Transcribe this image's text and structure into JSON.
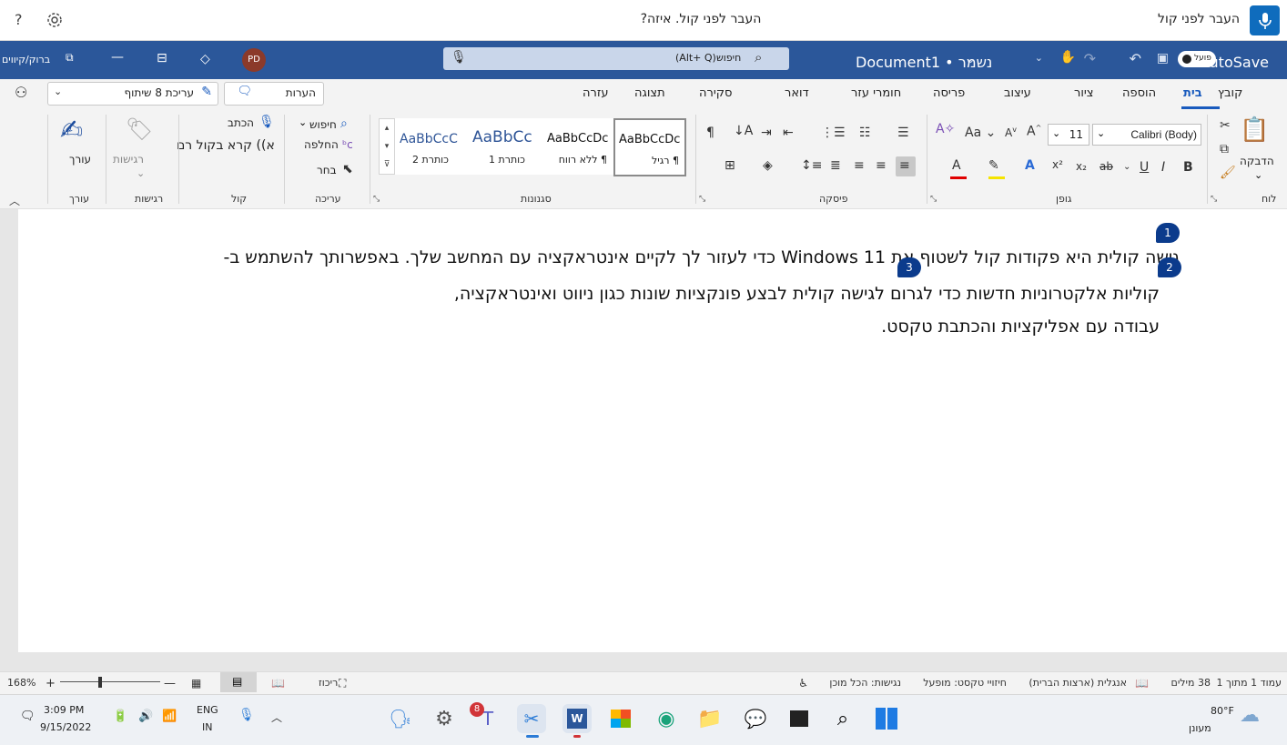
{
  "voice_bar": {
    "title": "העבר לפני קול",
    "status": "העבר לפני קול. איזה?",
    "help": "?"
  },
  "title_bar": {
    "autosave_label": "AutoSave",
    "autosave_state": "פועל",
    "doc_name": "Document1 • נשמר",
    "search_shortcut": "(Alt+ Q)",
    "search_label": "חיפוש",
    "user_initials": "PD",
    "immersive": "ברוק/קיווים"
  },
  "tabs": [
    "קובץ",
    "בית",
    "הוספה",
    "ציור",
    "עיצוב",
    "פריסה",
    "חומרי עזר",
    "דואר",
    "סקירה",
    "תצוגה",
    "עזרה"
  ],
  "ribbon_right": {
    "comments": "הערות",
    "editing": "עריכת 8 שיתוף"
  },
  "ribbon": {
    "paste": "הדבקה",
    "font_name": "Calibri (Body)",
    "font_size": "11",
    "styles": [
      {
        "sample": "AaBbCcDc",
        "name": "¶ רגיל"
      },
      {
        "sample": "AaBbCcDc",
        "name": "¶ ללא רווח"
      },
      {
        "sample": "AaBbCc",
        "name": "כותרת 1"
      },
      {
        "sample": "AaBbCcC",
        "name": "כותרת 2"
      }
    ],
    "find": "חיפוש",
    "replace": "החלפה",
    "select": "בחר",
    "dictate": "הכתב",
    "read_aloud": "א)) קרא בקול רם",
    "sensitivity": "רגישות",
    "editor": "עורך",
    "groups": {
      "clipboard": "לוח",
      "font": "גופן",
      "paragraph": "פיסקה",
      "styles": "סגנונות",
      "editing": "עריכה",
      "voice": "קול",
      "sensitivity": "רגישות",
      "editor": "עורך"
    }
  },
  "document": {
    "line1": "גישה קולית היא פקודות קול לשטוף את Windows 11 כדי לעזור לך לקיים אינטראקציה עם המחשב שלך. באפשרותך להשתמש ב-",
    "line2": "קוליות אלקטרוניות חדשות כדי לגרום לגישה קולית לבצע פונקציות שונות כגון ניווט ואינטראקציה,",
    "line3": "עבודה עם אפליקציות והכתבת טקסט.",
    "markers": [
      "1",
      "2",
      "3"
    ]
  },
  "status_bar": {
    "page": "עמוד 1 מתוך 1",
    "words": "38 מילים",
    "language": "אנגלית (ארצות הברית)",
    "text_predictions": "חיזויי טקסט: מופעל",
    "accessibility": "נגישות: הכל מוכן",
    "focus": "ריכוז",
    "zoom": "168%"
  },
  "taskbar": {
    "weather_temp": "80°F",
    "weather_desc": "מעונן",
    "lang": "ENG",
    "lang_sub": "IN",
    "time": "3:09 PM",
    "date": "9/15/2022",
    "teams_badge": "8"
  }
}
